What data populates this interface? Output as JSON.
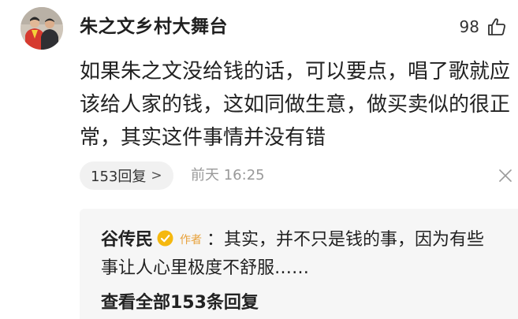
{
  "comment": {
    "username": "朱之文乡村大舞台",
    "like_count": "98",
    "content": "如果朱之文没给钱的话，可以要点，唱了歌就应该给人家的钱，这如同做生意，做买卖似的很正常，其实这件事情并没有错",
    "reply_count_label": "153回复",
    "reply_chevron": ">",
    "time": "前天 16:25",
    "icons": {
      "like": "thumbs-up-icon",
      "close": "close-icon",
      "verified": "verified-badge-icon"
    }
  },
  "reply_preview": {
    "name": "谷传民",
    "author_tag": "作者",
    "text": "：其实，并不只是钱的事，因为有些事让人心里极度不舒服……",
    "view_all_label": "查看全部153条回复"
  },
  "colors": {
    "verified_badge": "#f5b80f",
    "author_tag": "#e8a13a",
    "secondary_text": "#999999",
    "pill_bg": "#f1f1f1",
    "reply_bg": "#f6f6f6"
  }
}
